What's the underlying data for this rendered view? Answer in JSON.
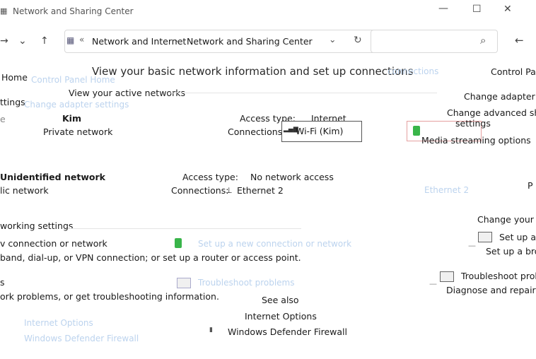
{
  "window": {
    "title": "Network and Sharing Center"
  },
  "address": {
    "chevron": "«",
    "crumbs": [
      "Network and Internet",
      "Network and Sharing Center"
    ]
  },
  "main": {
    "heading": "View your basic network information and set up connections",
    "active_networks_label": "View your active networks",
    "networks": [
      {
        "name": "Kim",
        "type": "Private network",
        "access_label": "Access type:",
        "access_value": "Internet",
        "connections_label": "Connections:",
        "connection": "Wi-Fi (Kim)"
      },
      {
        "name": "Unidentified network",
        "type": "lic network",
        "access_label": "Access type:",
        "access_value": "No network access",
        "connections_label": "Connections:",
        "connection": "Ethernet 2"
      }
    ],
    "change_settings_label": "working settings",
    "tasks": [
      {
        "title": "v connection or network",
        "desc": "band, dial-up, or VPN connection; or set up a router or access point."
      },
      {
        "title": "s",
        "desc": "ork problems, or get troubleshooting information."
      }
    ]
  },
  "left_nav": {
    "home": "Home",
    "settings": "ttings"
  },
  "right_panel": {
    "control_panel": "Control Pan",
    "change_adapter": "Change adapter set",
    "change_advanced": "Change advanced shari",
    "settings_word": "settings",
    "media_streaming": "Media streaming options",
    "p_letter": "P",
    "change_your_network": "Change your n",
    "set_up_new": "Set up a n",
    "set_up_broad": "Set up a broad",
    "troubleshoot": "Troubleshoot proble",
    "diagnose": "Diagnose and repair netw"
  },
  "see_also": {
    "label": "See also",
    "internet_options": "Internet Options",
    "firewall": "Windows Defender Firewall"
  },
  "icons": {
    "back": "←",
    "forward": "→",
    "down": "⌄",
    "up": "↑",
    "refresh": "↻",
    "search": "⌕",
    "minimize": "—",
    "maximize": "☐",
    "close": "✕",
    "breadcrumb_sep": "›",
    "dropdown": "⌄",
    "wifi_bars": "▂▄▆",
    "ethernet": "⊥"
  }
}
